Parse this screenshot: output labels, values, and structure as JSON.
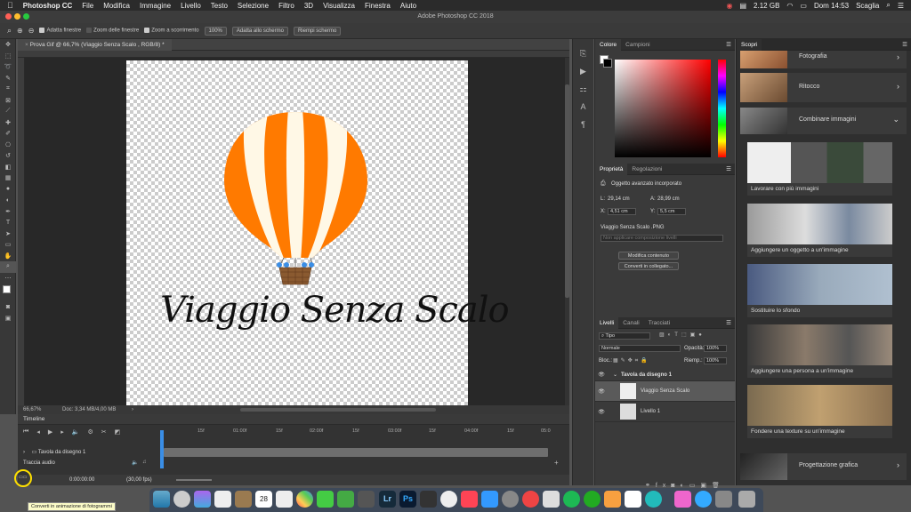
{
  "menubar": {
    "apple": "",
    "app": "Photoshop CC",
    "items": [
      "File",
      "Modifica",
      "Immagine",
      "Livello",
      "Testo",
      "Selezione",
      "Filtro",
      "3D",
      "Visualizza",
      "Finestra",
      "Aiuto"
    ],
    "memory": "2.12 GB",
    "clock": "Dom 14:53",
    "user": "Scaglia"
  },
  "window_title": "Adobe Photoshop CC 2018",
  "options": {
    "fit_windows": "Adatta finestre",
    "zoom_all": "Zoom delle finestre",
    "scrubby": "Zoom a scorrimento",
    "zoom_value": "100%",
    "fit_screen": "Adatta allo schermo",
    "fill_screen": "Riempi schermo"
  },
  "document": {
    "tab": "Prova Gif @ 66,7% (Viaggio Senza Scalo , RGB/8) *",
    "artwork_text": "Viaggio Senza Scalo",
    "zoom": "66,67%",
    "doc_size": "Doc: 3,34 MB/4,00 MB"
  },
  "timeline": {
    "title": "Timeline",
    "ticks": [
      "15f",
      "01:00f",
      "15f",
      "02:00f",
      "15f",
      "03:00f",
      "15f",
      "04:00f",
      "15f",
      "05:0"
    ],
    "group": "Tavola da disegno 1",
    "audio": "Traccia audio",
    "timecode": "0:00:00:00",
    "fps": "(30,00 fps)",
    "tooltip": "Converti in animazione di fotogrammi"
  },
  "color_panel": {
    "tabs": [
      "Colore",
      "Campioni"
    ]
  },
  "properties": {
    "tabs": [
      "Proprietà",
      "Regolazioni"
    ],
    "type": "Oggetto avanzato incorporato",
    "W_label": "L:",
    "W": "29,14 cm",
    "H_label": "A:",
    "H": "28,99 cm",
    "X_label": "X:",
    "X": "4,51 cm",
    "Y_label": "Y:",
    "Y": "5,5 cm",
    "file": "Viaggio Senza Scalo .PNG",
    "comp": "Non applicare composizione livelli",
    "edit_btn": "Modifica contenuto",
    "convert_btn": "Converti in collegato..."
  },
  "layers": {
    "tabs": [
      "Livelli",
      "Canali",
      "Tracciati"
    ],
    "filter": "Tipo",
    "blend": "Normale",
    "opacity_label": "Opacità:",
    "opacity": "100%",
    "lock_label": "Bloc.:",
    "fill_label": "Riemp.:",
    "fill": "100%",
    "items": [
      {
        "name": "Tavola da disegno 1"
      },
      {
        "name": "Viaggio Senza Scalo"
      },
      {
        "name": "Livello 1"
      }
    ]
  },
  "discover": {
    "tab": "Scopri",
    "items": [
      "Fotografia",
      "Ritocco",
      "Combinare immagini",
      "Lavorare con più immagini",
      "Aggiungere un oggetto a un'immagine",
      "Sostituire lo sfondo",
      "Aggiungere una persona a un'immagine",
      "Fondere una texture su un'immagine",
      "Progettazione grafica"
    ]
  },
  "dock": {
    "lr": "Lr",
    "ps": "Ps",
    "date": "28"
  }
}
